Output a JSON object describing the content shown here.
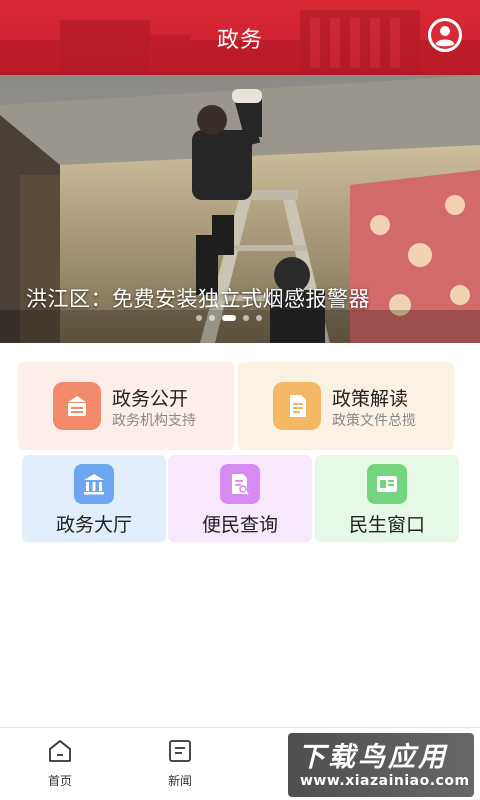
{
  "header": {
    "title": "政务",
    "user_icon": "user-circle-icon"
  },
  "banner": {
    "caption": "洪江区：免费安装独立式烟感报警器",
    "slide_count": 5,
    "active_slide": 3
  },
  "cards": {
    "gov_open": {
      "title": "政务公开",
      "subtitle": "政务机构支持",
      "icon": "notice-icon",
      "color": "#f08a6a",
      "bg": "#fdeee9"
    },
    "policy": {
      "title": "政策解读",
      "subtitle": "政策文件总揽",
      "icon": "document-icon",
      "color": "#f4b764",
      "bg": "#fdf1e3"
    },
    "hall": {
      "title": "政务大厅",
      "icon": "building-icon",
      "color": "#6ea5f0",
      "bg": "#e3eefd"
    },
    "query": {
      "title": "便民查询",
      "icon": "search-doc-icon",
      "color": "#d68bf0",
      "bg": "#f7e8fd"
    },
    "window": {
      "title": "民生窗口",
      "icon": "id-card-icon",
      "color": "#74d47f",
      "bg": "#e6f8e6"
    }
  },
  "tabbar": {
    "home": {
      "label": "首页",
      "icon": "home-icon"
    },
    "news": {
      "label": "新闻",
      "icon": "news-icon"
    }
  },
  "watermark": {
    "line1": "下载鸟应用",
    "line2": "www.xiazainiao.com"
  },
  "colors": {
    "brand": "#d92a35"
  }
}
